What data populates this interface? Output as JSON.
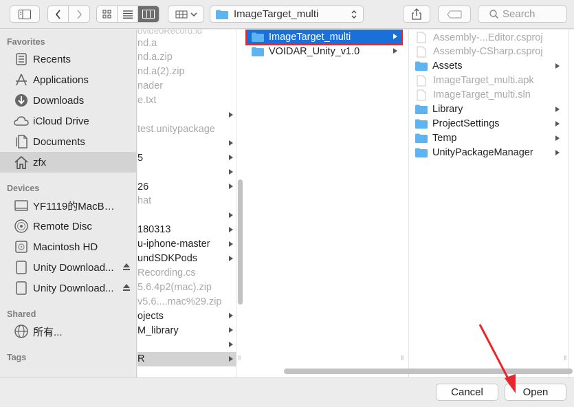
{
  "toolbar": {
    "path_folder": "ImageTarget_multi",
    "search_placeholder": "Search"
  },
  "sidebar": {
    "favorites_header": "Favorites",
    "favorites": [
      {
        "label": "Recents",
        "icon": "recents-icon"
      },
      {
        "label": "Applications",
        "icon": "applications-icon"
      },
      {
        "label": "Downloads",
        "icon": "downloads-icon"
      },
      {
        "label": "iCloud Drive",
        "icon": "cloud-icon"
      },
      {
        "label": "Documents",
        "icon": "documents-icon"
      },
      {
        "label": "zfx",
        "icon": "home-icon",
        "selected": true
      }
    ],
    "devices_header": "Devices",
    "devices": [
      {
        "label": "YF1119的MacBook...",
        "icon": "laptop-icon"
      },
      {
        "label": "Remote Disc",
        "icon": "disc-icon"
      },
      {
        "label": "Macintosh HD",
        "icon": "harddisk-icon"
      },
      {
        "label": "Unity Download...",
        "icon": "drive-icon",
        "eject": true
      },
      {
        "label": "Unity Download...",
        "icon": "drive-icon",
        "eject": true
      }
    ],
    "shared_header": "Shared",
    "shared": [
      {
        "label": "所有...",
        "icon": "network-icon"
      }
    ],
    "tags_header": "Tags"
  },
  "column1": {
    "rows": [
      {
        "text": "nd.a",
        "style": "grey",
        "arrow": false
      },
      {
        "text": "nd.a.zip",
        "style": "grey",
        "arrow": false
      },
      {
        "text": "nd.a(2).zip",
        "style": "grey",
        "arrow": false
      },
      {
        "text": "nader",
        "style": "grey",
        "arrow": false
      },
      {
        "text": "e.txt",
        "style": "grey",
        "arrow": false
      },
      {
        "text": "",
        "style": "dark",
        "arrow": true
      },
      {
        "text": "test.unitypackage",
        "style": "grey",
        "arrow": false
      },
      {
        "text": "",
        "style": "dark",
        "arrow": true
      },
      {
        "text": "5",
        "style": "dark",
        "arrow": true
      },
      {
        "text": "",
        "style": "dark",
        "arrow": true
      },
      {
        "text": "26",
        "style": "dark",
        "arrow": true
      },
      {
        "text": "hat",
        "style": "grey",
        "arrow": false
      },
      {
        "text": "",
        "style": "dark",
        "arrow": true
      },
      {
        "text": "180313",
        "style": "dark",
        "arrow": true
      },
      {
        "text": "u-iphone-master",
        "style": "dark",
        "arrow": true
      },
      {
        "text": "undSDKPods",
        "style": "dark",
        "arrow": true
      },
      {
        "text": "Recording.cs",
        "style": "grey",
        "arrow": false
      },
      {
        "text": "5.6.4p2(mac).zip",
        "style": "grey",
        "arrow": false
      },
      {
        "text": "v5.6....mac%29.zip",
        "style": "grey",
        "arrow": false
      },
      {
        "text": "ojects",
        "style": "dark",
        "arrow": true
      },
      {
        "text": "M_library",
        "style": "dark",
        "arrow": true
      },
      {
        "text": "",
        "style": "dark",
        "arrow": true
      },
      {
        "text": "R",
        "style": "dark",
        "arrow": true,
        "selected": true
      }
    ]
  },
  "column2": {
    "rows": [
      {
        "text": "ImageTarget_multi",
        "selected": true
      },
      {
        "text": "VOIDAR_Unity_v1.0",
        "selected": false
      }
    ]
  },
  "column3": {
    "rows": [
      {
        "text": "Assembly-...Editor.csproj",
        "kind": "file",
        "style": "grey"
      },
      {
        "text": "Assembly-CSharp.csproj",
        "kind": "file",
        "style": "grey"
      },
      {
        "text": "Assets",
        "kind": "folder",
        "style": "dark"
      },
      {
        "text": "ImageTarget_multi.apk",
        "kind": "file",
        "style": "grey"
      },
      {
        "text": "ImageTarget_multi.sln",
        "kind": "file",
        "style": "grey"
      },
      {
        "text": "Library",
        "kind": "folder",
        "style": "dark"
      },
      {
        "text": "ProjectSettings",
        "kind": "folder",
        "style": "dark"
      },
      {
        "text": "Temp",
        "kind": "folder",
        "style": "dark"
      },
      {
        "text": "UnityPackageManager",
        "kind": "folder",
        "style": "dark"
      }
    ]
  },
  "buttons": {
    "cancel": "Cancel",
    "open": "Open"
  },
  "colors": {
    "selection_blue": "#1a6fd8",
    "annotation_red": "#e8262b",
    "folder_blue": "#5db4ef"
  }
}
